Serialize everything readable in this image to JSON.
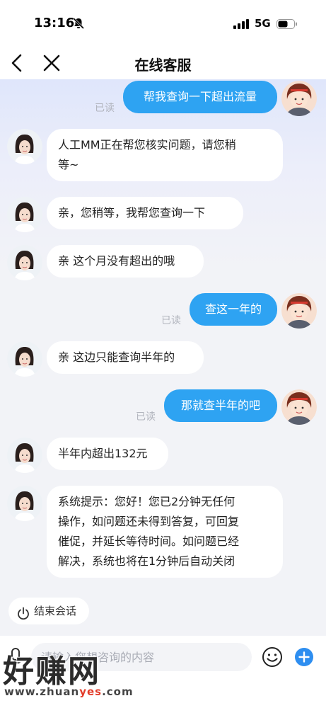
{
  "status_bar": {
    "time": "13:16",
    "network": "5G"
  },
  "nav": {
    "title": "在线客服",
    "back_icon": "chevron-left-icon",
    "close_icon": "close-icon"
  },
  "read_label": "已读",
  "messages": [
    {
      "from": "user",
      "text": "帮我查询一下超出流量",
      "read": "已读"
    },
    {
      "from": "agent",
      "lines": [
        "人工MM正在帮您核实问题，请您稍",
        "等~"
      ]
    },
    {
      "from": "agent",
      "text": "亲，您稍等，我帮您查询一下"
    },
    {
      "from": "agent",
      "text": "亲 这个月没有超出的哦"
    },
    {
      "from": "user",
      "text": "查这一年的",
      "read": "已读"
    },
    {
      "from": "agent",
      "text": "亲 这边只能查询半年的"
    },
    {
      "from": "user",
      "text": "那就查半年的吧",
      "read": "已读"
    },
    {
      "from": "agent",
      "text": "半年内超出132元"
    },
    {
      "from": "agent",
      "lines": [
        "系统提示：您好！您已2分钟无任何",
        "操作，如问题还未得到答复，可回复",
        "催促，并延长等待时间。如问题已经",
        "解决，系统也将在1分钟后自动关闭"
      ]
    }
  ],
  "end_session": {
    "label": "结束会话",
    "icon": "power-icon"
  },
  "input": {
    "placeholder": "请输入您想咨询的内容",
    "attach_icon": "mic-icon",
    "emoji_icon": "smiley-icon",
    "plus_icon": "plus-icon"
  },
  "watermark": {
    "title": "好赚网",
    "url_prefix": "www.zhuan",
    "url_highlight": "yes",
    "url_suffix": ".com"
  },
  "colors": {
    "user_bubble": "#2ea3f2",
    "agent_bubble": "#ffffff",
    "read_text": "#b1b4bd",
    "plus_button": "#2e8ef0"
  }
}
